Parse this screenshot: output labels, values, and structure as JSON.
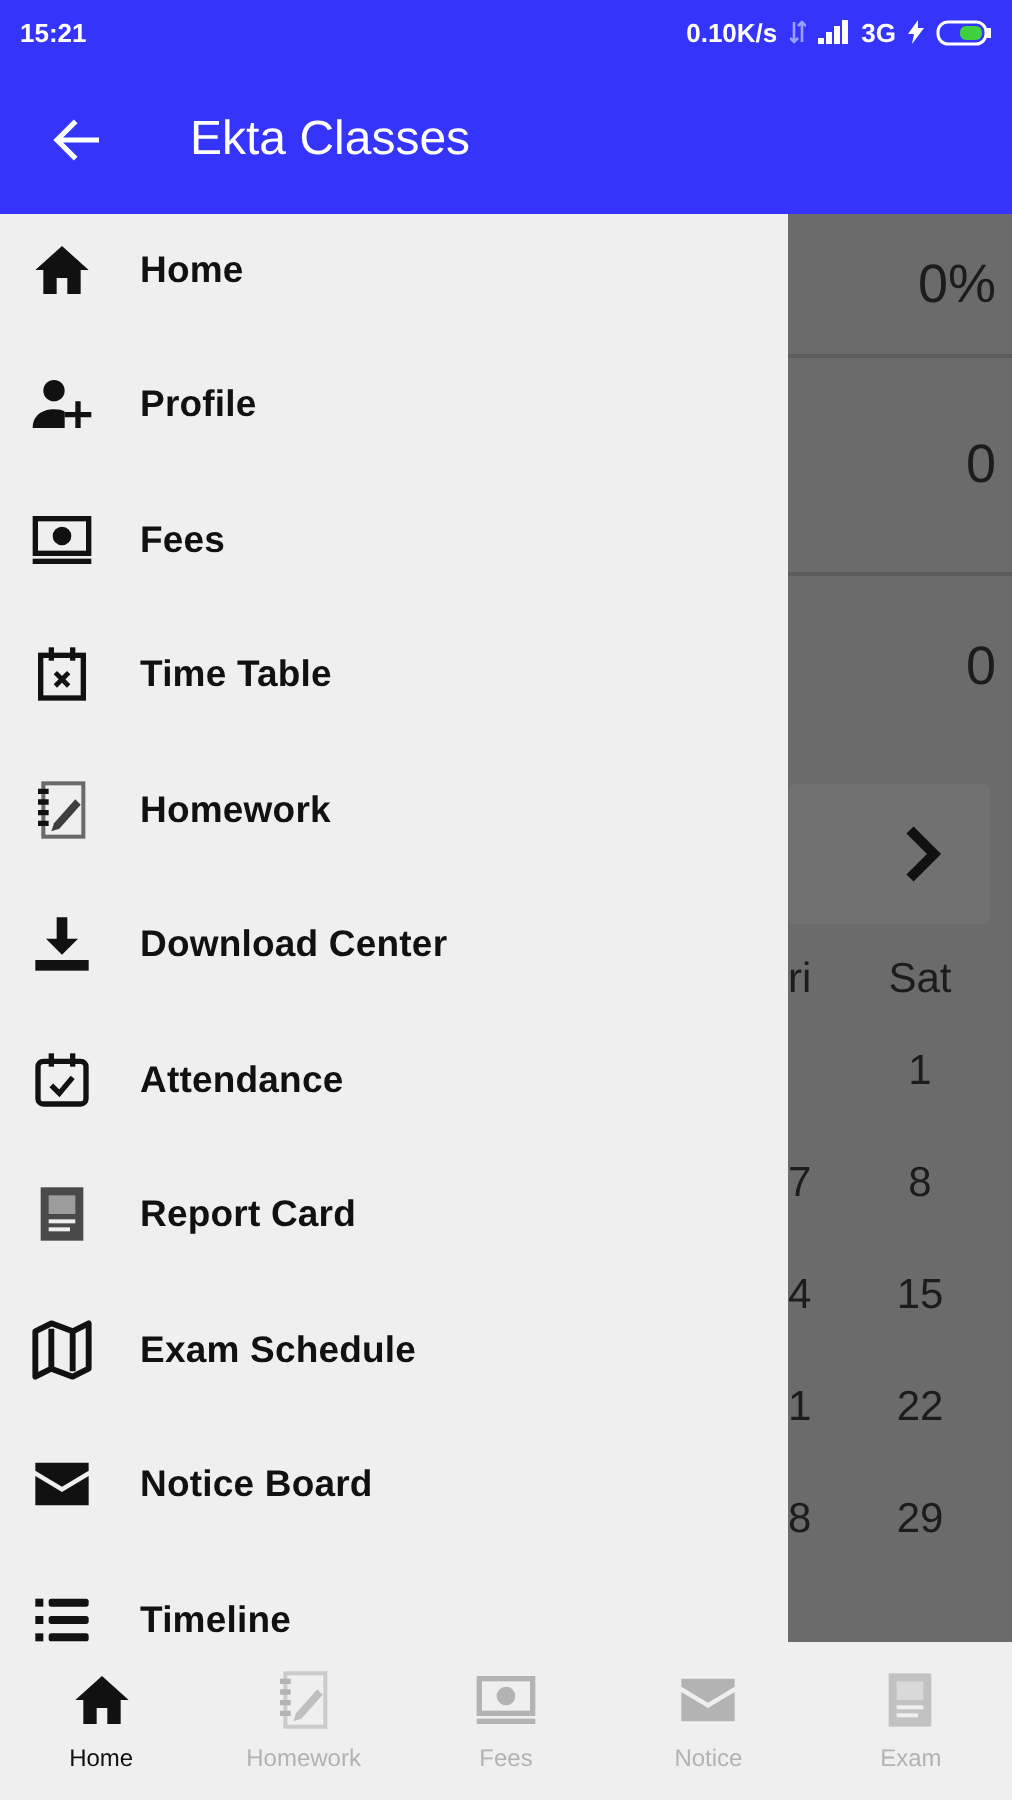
{
  "status_bar": {
    "time": "15:21",
    "speed": "0.10K/s",
    "network": "3G"
  },
  "app_bar": {
    "title": "Ekta Classes"
  },
  "drawer": {
    "items": [
      {
        "label": "Home"
      },
      {
        "label": "Profile"
      },
      {
        "label": "Fees"
      },
      {
        "label": "Time Table"
      },
      {
        "label": "Homework"
      },
      {
        "label": "Download Center"
      },
      {
        "label": "Attendance"
      },
      {
        "label": "Report Card"
      },
      {
        "label": "Exam Schedule"
      },
      {
        "label": "Notice Board"
      },
      {
        "label": "Timeline"
      }
    ]
  },
  "background": {
    "stats": [
      "0%",
      "0",
      "0"
    ],
    "calendar": {
      "headers": [
        "ri",
        "Sat"
      ],
      "rows": [
        [
          "",
          "1"
        ],
        [
          "7",
          "8"
        ],
        [
          "4",
          "15"
        ],
        [
          "1",
          "22"
        ],
        [
          "8",
          "29"
        ]
      ]
    }
  },
  "bottom_nav": [
    {
      "label": "Home",
      "selected": true
    },
    {
      "label": "Homework",
      "selected": false
    },
    {
      "label": "Fees",
      "selected": false
    },
    {
      "label": "Notice",
      "selected": false
    },
    {
      "label": "Exam",
      "selected": false
    }
  ]
}
